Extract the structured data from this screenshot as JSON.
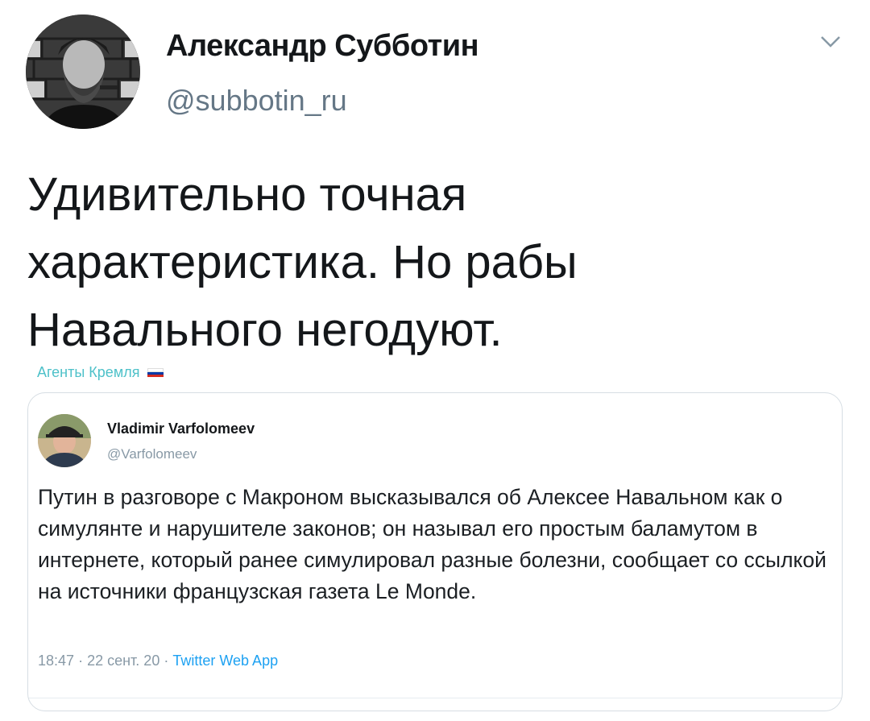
{
  "author": {
    "name": "Александр Субботин",
    "handle": "@subbotin_ru",
    "avatar_icon": "user-avatar-photo"
  },
  "tweet": {
    "text": "Удивительно точная\nхарактеристика. Но рабы\nНавального негодуют.",
    "source_label": "Агенты Кремля",
    "source_icon": "russia-flag-icon"
  },
  "quoted": {
    "author_name": "Vladimir Varfolomeev",
    "author_handle": "@Varfolomeev",
    "text": "Путин в разговоре с Макроном высказывался об Алексее Навальном как о симулянте и нарушителе законов; он называл его простым баламутом в интернете, который ранее симулировал разные болезни, сообщает со ссылкой на источники французская газета Le Monde.",
    "time": "18:47",
    "date": "22 сент. 20",
    "app": "Twitter Web App",
    "separator": "·"
  },
  "colors": {
    "text": "#14171a",
    "secondary": "#657786",
    "link": "#1da1f2",
    "source": "#4ec1c9",
    "border": "#d6dde3"
  }
}
